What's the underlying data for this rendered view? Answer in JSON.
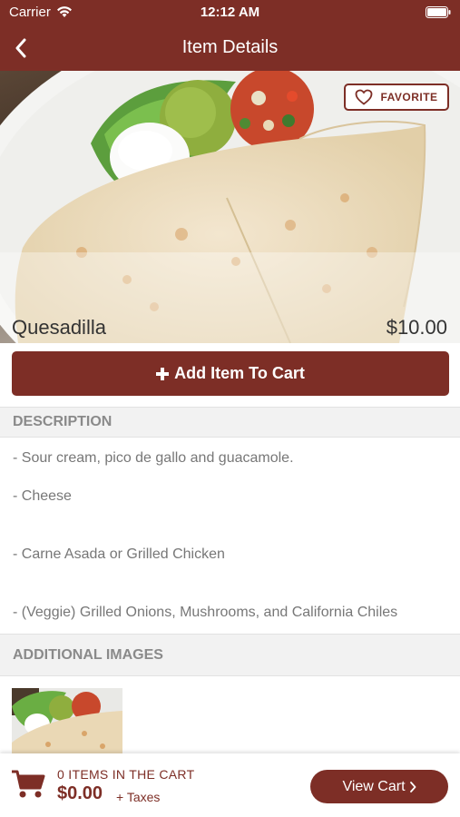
{
  "status_bar": {
    "carrier": "Carrier",
    "time": "12:12 AM"
  },
  "nav": {
    "title": "Item Details"
  },
  "item": {
    "favorite_label": "FAVORITE",
    "name": "Quesadilla",
    "price": "$10.00",
    "add_to_cart_label": "Add Item To Cart"
  },
  "description": {
    "header": "DESCRIPTION",
    "lines": [
      "- Sour cream, pico de gallo and guacamole.",
      "- Cheese",
      "- Carne Asada or Grilled Chicken",
      "- (Veggie) Grilled Onions, Mushrooms, and California Chiles"
    ]
  },
  "additional_images": {
    "header": "ADDITIONAL IMAGES"
  },
  "cart": {
    "count_text": "0 ITEMS IN THE CART",
    "total": "$0.00",
    "taxes_label": "+ Taxes",
    "view_cart_label": "View Cart"
  },
  "colors": {
    "brand": "#7d2e26"
  },
  "icons": {
    "back": "chevron-left-icon",
    "favorite": "heart-icon",
    "add": "plus-icon",
    "cart": "shopping-cart-icon",
    "view_cart": "chevron-right-icon"
  }
}
